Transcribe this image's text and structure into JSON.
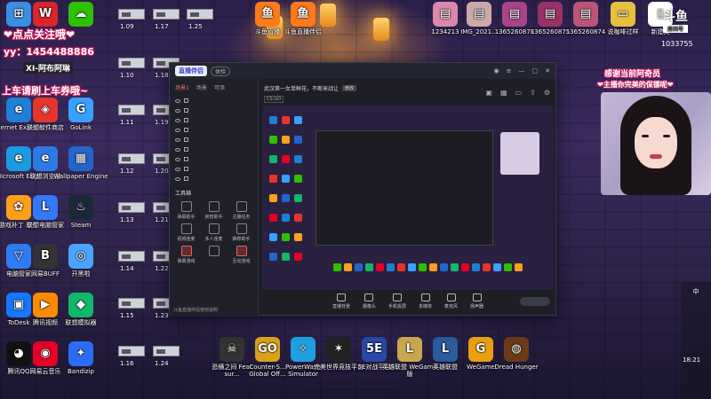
{
  "overlay": {
    "line1": "❤点点关注哦❤",
    "line2": "yy：1454488886",
    "badge": "XI-阿布阿琳",
    "line3": "上车请刷上车券哦~",
    "right1": "感谢当前阿奇员",
    "right2": "❤主播你完美的保镖呢❤"
  },
  "desktop_icons_left": [
    {
      "label": "",
      "icon": "windows-icon",
      "color": "#3a8ee6",
      "glyph": "⊞"
    },
    {
      "label": "",
      "icon": "wps-icon",
      "color": "#d9262c",
      "glyph": "W"
    },
    {
      "label": "",
      "icon": "wechat-icon",
      "color": "#2dc100",
      "glyph": "☁"
    },
    {
      "label": "Internet Explorer",
      "icon": "ie-icon",
      "color": "#1e7fd6",
      "glyph": "e"
    },
    {
      "label": "联想软件商店",
      "icon": "lenovo-store-icon",
      "color": "#e8352c",
      "glyph": "◈"
    },
    {
      "label": "GoLink",
      "icon": "golink-icon",
      "color": "#3aa0ff",
      "glyph": "G"
    },
    {
      "label": "Microsoft Edge",
      "icon": "edge-icon",
      "color": "#1a9be0",
      "glyph": "e"
    },
    {
      "label": "联想浏览器",
      "icon": "lenovo-browser-icon",
      "color": "#2c7be5",
      "glyph": "e"
    },
    {
      "label": "Wallpaper Engine",
      "icon": "wallpaper-engine-icon",
      "color": "#2266cc",
      "glyph": "▦"
    },
    {
      "label": "游戏补丁 软件",
      "icon": "pinwheel-icon",
      "color": "#ff9f1a",
      "glyph": "✿"
    },
    {
      "label": "联想电脑管家",
      "icon": "lenovo-manager-icon",
      "color": "#3478f6",
      "glyph": "L"
    },
    {
      "label": "Steam",
      "icon": "steam-icon",
      "color": "#1b2838",
      "glyph": "♨"
    },
    {
      "label": "电脑管家",
      "icon": "pc-manager-icon",
      "color": "#2f7bf5",
      "glyph": "▽"
    },
    {
      "label": "网易BUFF",
      "icon": "buff-icon",
      "color": "#333",
      "glyph": "B"
    },
    {
      "label": "开黑啦",
      "icon": "kaiheila-icon",
      "color": "#4aa3ff",
      "glyph": "◎"
    },
    {
      "label": "ToDesk",
      "icon": "todesk-icon",
      "color": "#1677ff",
      "glyph": "▣"
    },
    {
      "label": "腾讯视频",
      "icon": "tencent-video-icon",
      "color": "#ff8a00",
      "glyph": "▶"
    },
    {
      "label": "联想模拟器",
      "icon": "emulator-icon",
      "color": "#12b76a",
      "glyph": "◆"
    },
    {
      "label": "腾讯QQ",
      "icon": "qq-icon",
      "color": "#111",
      "glyph": "◕"
    },
    {
      "label": "网易云音乐",
      "icon": "netease-music-icon",
      "color": "#e60026",
      "glyph": "◉"
    },
    {
      "label": "Bandizip",
      "icon": "bandizip-icon",
      "color": "#2a6df4",
      "glyph": "✦"
    }
  ],
  "thumb_labels": [
    "1.09",
    "1.17",
    "1.25",
    "1.10",
    "1.18",
    "1.11",
    "1.19",
    "1.12",
    "1.20",
    "1.13",
    "1.21",
    "1.14",
    "1.22",
    "1.15",
    "1.23",
    "1.16",
    "1.24"
  ],
  "desktop_icons_top": [
    {
      "label": "斗鱼直播",
      "icon": "douyu-icon",
      "color": "#ff7a1a",
      "glyph": "鱼"
    },
    {
      "label": "斗鱼直播伴侣",
      "icon": "douyu-companion-icon",
      "color": "#ff7a1a",
      "glyph": "鱼"
    },
    {
      "label": "1234213",
      "icon": "photo-icon",
      "color": "#d8a",
      "glyph": "▤"
    },
    {
      "label": "IMG_2021...",
      "icon": "photo-icon",
      "color": "#caa",
      "glyph": "▤"
    },
    {
      "label": "1365260876",
      "icon": "photo-icon",
      "color": "#a48",
      "glyph": "▤"
    },
    {
      "label": "1365260875",
      "icon": "photo-icon",
      "color": "#936",
      "glyph": "▤"
    },
    {
      "label": "1365260874",
      "icon": "photo-icon",
      "color": "#b57",
      "glyph": "▤"
    },
    {
      "label": "说咖啡过样",
      "icon": "folder-icon",
      "color": "#e8c040",
      "glyph": "▭"
    },
    {
      "label": "新建文",
      "icon": "document-icon",
      "color": "#fff",
      "glyph": "▯"
    }
  ],
  "desktop_icons_bottom": [
    {
      "label": "恐横之间 Fear sur...",
      "icon": "fear-icon",
      "color": "#333",
      "glyph": "☠"
    },
    {
      "label": "Counter-S... Global Off...",
      "icon": "csgo-icon",
      "color": "#d9a21b",
      "glyph": "GO"
    },
    {
      "label": "PowerWash Simulator",
      "icon": "powerwash-icon",
      "color": "#1ea0e0",
      "glyph": "✧"
    },
    {
      "label": "完美世界竞技平台",
      "icon": "perfect-world-icon",
      "color": "#222",
      "glyph": "✶"
    },
    {
      "label": "5E对战平台",
      "icon": "5e-icon",
      "color": "#2848a8",
      "glyph": "5E"
    },
    {
      "label": "英雄联盟 WeGame版",
      "icon": "lol-wegame-icon",
      "color": "#c8a84e",
      "glyph": "L"
    },
    {
      "label": "英雄联盟",
      "icon": "lol-icon",
      "color": "#2a5b9a",
      "glyph": "L"
    },
    {
      "label": "WeGame",
      "icon": "wegame-icon",
      "color": "#e8a010",
      "glyph": "G"
    },
    {
      "label": "Dread Hunger",
      "icon": "dread-hunger-icon",
      "color": "#6b3a1a",
      "glyph": "◍"
    }
  ],
  "window": {
    "app_name": "直播伴侣",
    "version": "体验",
    "tabs": [
      "场景1",
      "场景",
      "可添"
    ],
    "sources": [
      "",
      "",
      "",
      "",
      "",
      "",
      "",
      "",
      ""
    ],
    "tools_title": "工具箱",
    "tools": [
      {
        "label": "弹幕助手",
        "red": false
      },
      {
        "label": "房管助手",
        "red": false
      },
      {
        "label": "主播任务",
        "red": false
      },
      {
        "label": "视频连麦",
        "red": false
      },
      {
        "label": "多人连麦",
        "red": false
      },
      {
        "label": "推荐助手",
        "red": false
      },
      {
        "label": "弹幕游戏",
        "red": true
      },
      {
        "label": "",
        "red": false
      },
      {
        "label": "互动游戏",
        "red": true
      }
    ],
    "bottom_note": "斗鱼直播伴侣使用说明",
    "topic": "武汉第一女单鲜花，不断来战让",
    "topic_edit": "修改",
    "meta": [
      "CS:GO",
      "",
      ""
    ],
    "controls": [
      "直播背景",
      "摄像头",
      "手机投屏",
      "多媒体",
      "麦克风",
      "扬声器"
    ],
    "start_label": "",
    "status": [
      "",
      "",
      "",
      "",
      ""
    ]
  },
  "top_right_logo": "斗鱼",
  "top_right_sub": "房间号",
  "top_right_num": "1033755",
  "tray": [
    "",
    "",
    "",
    "",
    "中"
  ],
  "clock": "18:21"
}
